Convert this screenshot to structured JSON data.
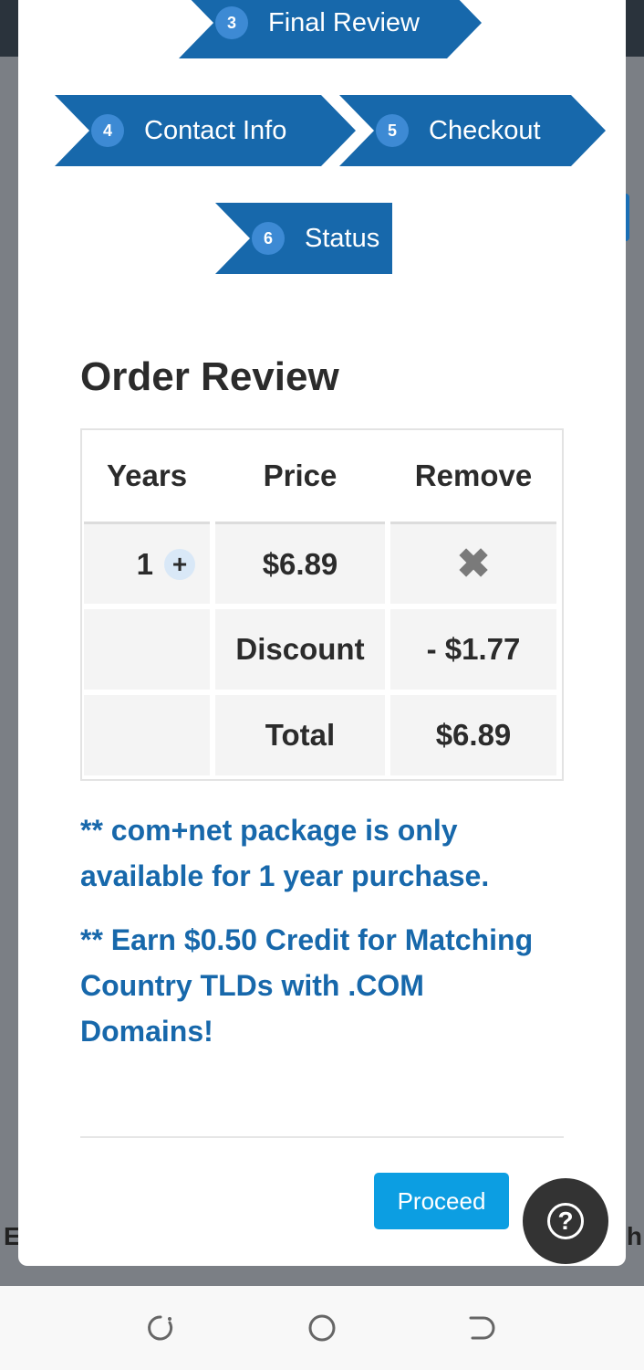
{
  "steps": [
    {
      "num": "3",
      "label": "Final Review"
    },
    {
      "num": "4",
      "label": "Contact Info"
    },
    {
      "num": "5",
      "label": "Checkout"
    },
    {
      "num": "6",
      "label": "Status"
    }
  ],
  "order": {
    "title": "Order Review",
    "headers": {
      "years": "Years",
      "price": "Price",
      "remove": "Remove"
    },
    "item": {
      "years": "1",
      "plus": "+",
      "price": "$6.89",
      "remove": "✖"
    },
    "discount": {
      "label": "Discount",
      "value": "- $1.77"
    },
    "total": {
      "label": "Total",
      "value": "$6.89"
    }
  },
  "notes": [
    "** com+net package is only available for 1 year purchase.",
    "** Earn $0.50 Credit for Matching Country TLDs with .COM Domains!"
  ],
  "actions": {
    "proceed": "Proceed",
    "help": "?"
  },
  "background": {
    "left_letter": "E",
    "right_letter": "h"
  },
  "colors": {
    "step_blue": "#1768ab",
    "note_blue": "#1768ab",
    "proceed_blue": "#0c9ee2"
  },
  "icons": {
    "remove": "close-x-icon",
    "help": "question-circle-icon",
    "nav": [
      "recent-apps-icon",
      "home-icon",
      "back-icon"
    ]
  }
}
